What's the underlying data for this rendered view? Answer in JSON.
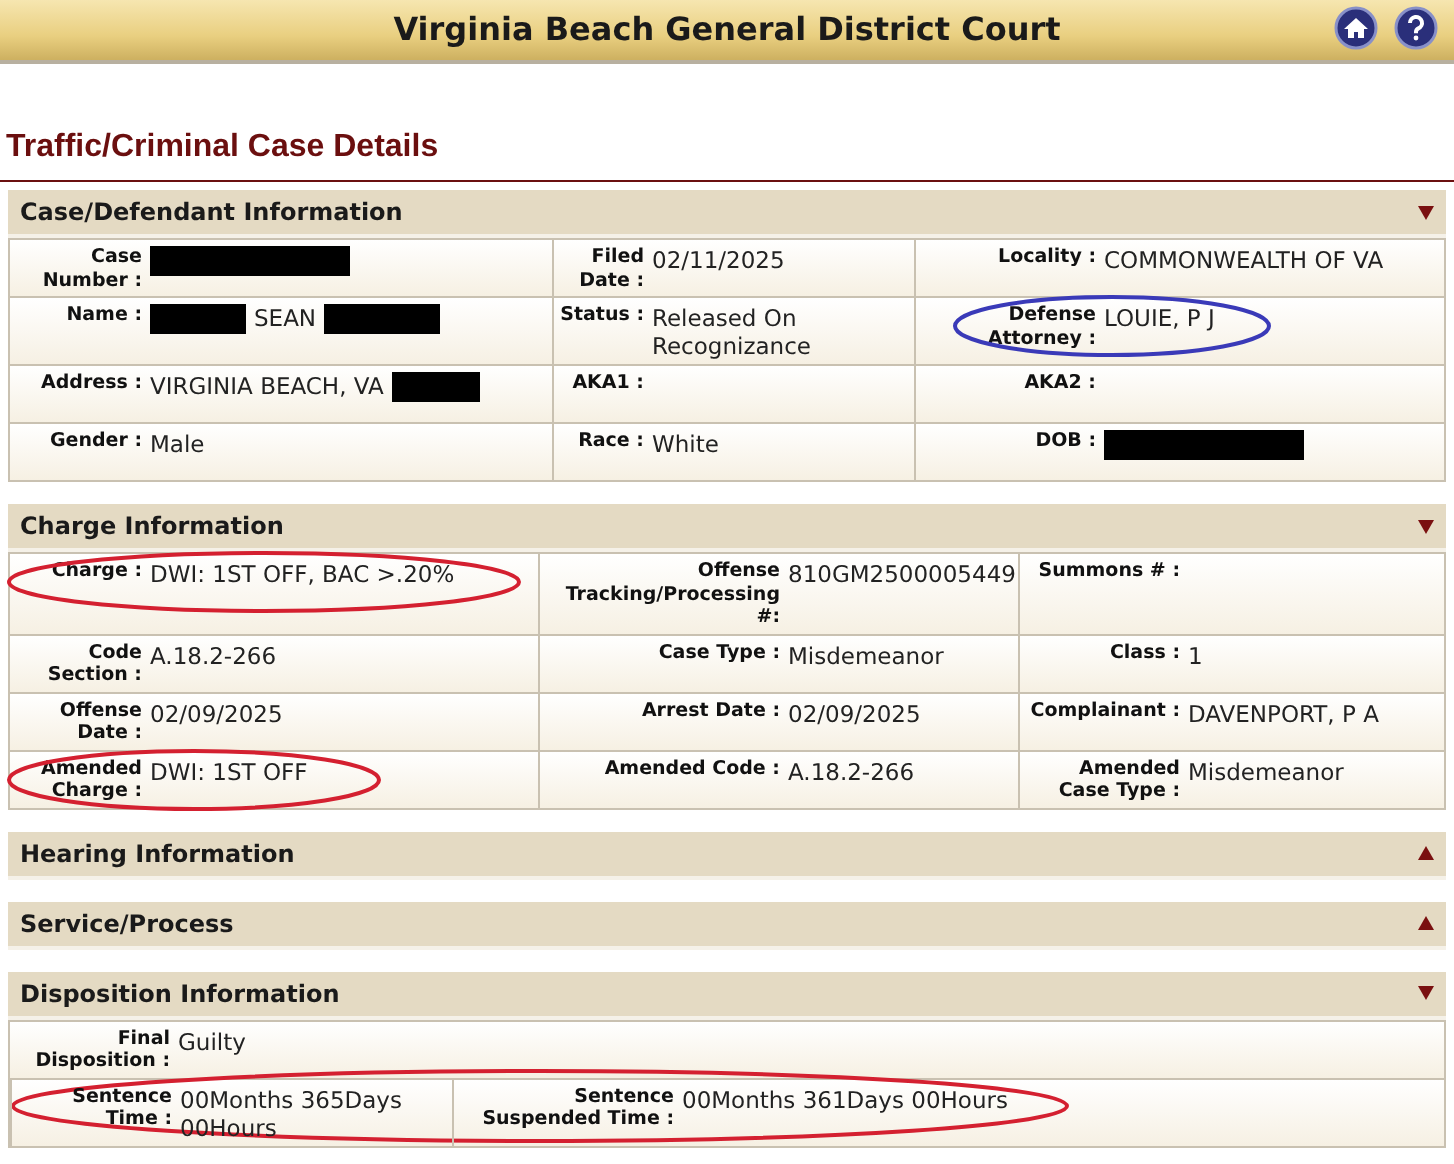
{
  "header": {
    "title": "Virginia Beach General District Court"
  },
  "page_title": "Traffic/Criminal Case Details",
  "sections": [
    {
      "title": "Case/Defendant Information",
      "expanded": true,
      "rows": [
        [
          {
            "label": "Case Number :",
            "redacted_after": true
          },
          {
            "label": "Filed Date :",
            "value": "02/11/2025"
          },
          {
            "label": "Locality :",
            "value": "COMMONWEALTH OF VA"
          }
        ],
        [
          {
            "label": "Name :",
            "value": "SEAN",
            "redacted_before": true,
            "redacted_after": true
          },
          {
            "label": "Status :",
            "value": "Released On Recognizance"
          },
          {
            "label": "Defense Attorney :",
            "value": "LOUIE, P J",
            "circle": {
              "color": "#3a3ab8",
              "whole_row": false
            }
          }
        ],
        [
          {
            "label": "Address :",
            "value": "VIRGINIA BEACH, VA",
            "redacted_after": true
          },
          {
            "label": "AKA1 :"
          },
          {
            "label": "AKA2 :"
          }
        ],
        [
          {
            "label": "Gender :",
            "value": "Male"
          },
          {
            "label": "Race :",
            "value": "White"
          },
          {
            "label": "DOB :",
            "redacted_after": true
          }
        ]
      ]
    },
    {
      "title": "Charge Information",
      "expanded": true,
      "rows": [
        [
          {
            "label": "Charge :",
            "value": "DWI: 1ST OFF, BAC >.20%",
            "circle": {
              "color": "#d42030",
              "whole_row": false
            }
          },
          {
            "label": "Offense Tracking/Processing #:",
            "value": "810GM2500005449"
          },
          {
            "label": "Summons # :"
          }
        ],
        [
          {
            "label": "Code Section :",
            "value": "A.18.2-266"
          },
          {
            "label": "Case Type :",
            "value": "Misdemeanor"
          },
          {
            "label": "Class :",
            "value": "1"
          }
        ],
        [
          {
            "label": "Offense Date :",
            "value": "02/09/2025"
          },
          {
            "label": "Arrest Date :",
            "value": "02/09/2025"
          },
          {
            "label": "Complainant :",
            "value": "DAVENPORT, P A"
          }
        ],
        [
          {
            "label": "Amended Charge :",
            "value": "DWI: 1ST OFF",
            "circle": {
              "color": "#d42030",
              "whole_row": false
            }
          },
          {
            "label": "Amended Code :",
            "value": "A.18.2-266"
          },
          {
            "label": "Amended Case Type :",
            "value": "Misdemeanor"
          }
        ]
      ]
    },
    {
      "title": "Hearing Information",
      "expanded": false
    },
    {
      "title": "Service/Process",
      "expanded": false
    },
    {
      "title": "Disposition Information",
      "expanded": true,
      "rows": [
        [
          {
            "label": "Final Disposition :",
            "value": "Guilty"
          }
        ],
        [
          {
            "label": "Sentence Time :",
            "value": "00Months 365Days 00Hours",
            "circle": {
              "color": "#d42030",
              "whole_row": true
            }
          },
          {
            "label": "Sentence Suspended Time :",
            "value": "00Months 361Days 00Hours"
          }
        ]
      ]
    }
  ]
}
